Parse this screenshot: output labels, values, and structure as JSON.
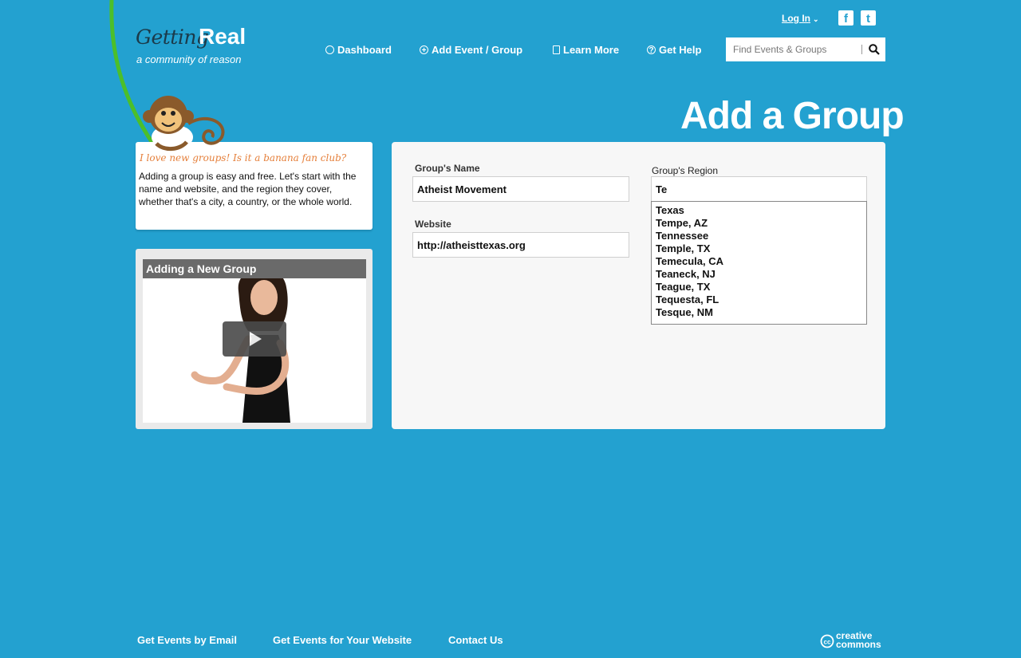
{
  "logo": {
    "word1": "Getting",
    "word2": "Real",
    "tagline": "a community of reason"
  },
  "header": {
    "login_label": "Log In",
    "social": {
      "facebook": "f",
      "twitter": "t"
    }
  },
  "nav": {
    "items": [
      {
        "label": "Dashboard",
        "icon": "dashboard-icon"
      },
      {
        "label": "Add Event / Group",
        "icon": "plus-circle-icon"
      },
      {
        "label": "Learn More",
        "icon": "book-icon"
      },
      {
        "label": "Get Help",
        "icon": "question-icon"
      }
    ]
  },
  "search": {
    "placeholder": "Find Events & Groups",
    "value": "",
    "icon": "search-icon"
  },
  "page": {
    "title": "Add a Group"
  },
  "info": {
    "tagline": "I love new groups! Is it a banana fan club?",
    "body": "Adding a group is easy and free. Let's start with the name and website, and the region they cover, whether that's a city, a country, or the whole world."
  },
  "video": {
    "title": "Adding a New Group",
    "icon": "play-icon"
  },
  "form": {
    "name_label": "Group's Name",
    "name_value": "Atheist Movement",
    "website_label": "Website",
    "website_value": "http://atheisttexas.org",
    "region_label": "Group's Region",
    "region_value": "Te",
    "region_suggestions": [
      "Texas",
      "Tempe, AZ",
      "Tennessee",
      "Temple, TX",
      "Temecula, CA",
      "Teaneck, NJ",
      "Teague, TX",
      "Tequesta, FL",
      "Tesque, NM"
    ]
  },
  "footer": {
    "links": [
      "Get Events by Email",
      "Get Events for Your Website",
      "Contact Us"
    ],
    "cc_line1": "creative",
    "cc_line2": "commons"
  },
  "colors": {
    "background": "#23a1d0",
    "panel": "#f7f7f7",
    "accent_orange": "#e57f3a",
    "vine_green": "#4cbf2a"
  }
}
